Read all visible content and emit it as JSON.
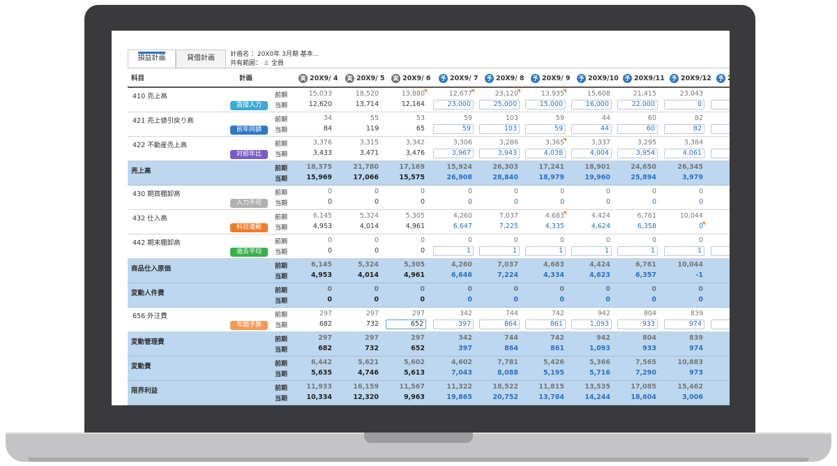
{
  "tabs": [
    {
      "label": "損益計画",
      "active": true
    },
    {
      "label": "貸借計画",
      "active": false
    }
  ],
  "plan": {
    "name_label": "計画名",
    "name_value": "：20X0年 3月期 基本...",
    "scope_label": "共有範囲：",
    "scope_value": "全員"
  },
  "header": {
    "account": "科目",
    "method": "計画",
    "months": [
      {
        "label": "20X9/ 4",
        "kind": "実"
      },
      {
        "label": "20X9/ 5",
        "kind": "実"
      },
      {
        "label": "20X9/ 6",
        "kind": "実"
      },
      {
        "label": "20X9/ 7",
        "kind": "予"
      },
      {
        "label": "20X9/ 8",
        "kind": "予"
      },
      {
        "label": "20X9/ 9",
        "kind": "予"
      },
      {
        "label": "20X9/10",
        "kind": "予"
      },
      {
        "label": "20X9/11",
        "kind": "予"
      },
      {
        "label": "20X9/12",
        "kind": "予"
      },
      {
        "label": "2",
        "kind": "予"
      }
    ]
  },
  "period_labels": {
    "prev": "前期",
    "curr": "当期"
  },
  "colors": {
    "actual_badge": "#707070",
    "forecast_badge": "#2a76c8",
    "total_row": "#bcd7ef",
    "input_text": "#2a6fc9"
  },
  "rows": [
    {
      "account": "410 売上高",
      "total": false,
      "method": "直接入力",
      "method_color": "#3aa9d8",
      "prev": [
        "15,033",
        "18,520",
        "13,880",
        "12,677",
        "23,120",
        "13,935",
        "15,608",
        "21,415",
        "23,043"
      ],
      "curr": [
        "12,620",
        "13,714",
        "12,164",
        "23,000",
        "25,000",
        "15,000",
        "16,000",
        "22,000",
        "0"
      ],
      "flags": [
        2,
        3,
        4,
        5
      ]
    },
    {
      "account": "421 売上値引戻り高",
      "total": false,
      "method": "前年同額",
      "method_color": "#2e78c7",
      "prev": [
        "34",
        "55",
        "53",
        "59",
        "103",
        "59",
        "44",
        "60",
        "82"
      ],
      "curr": [
        "84",
        "119",
        "65",
        "59",
        "103",
        "59",
        "44",
        "60",
        "82"
      ]
    },
    {
      "account": "422 不動産売上高",
      "total": false,
      "method": "対前年比",
      "method_color": "#7a5cc7",
      "prev": [
        "3,376",
        "3,315",
        "3,342",
        "3,306",
        "3,286",
        "3,365",
        "3,337",
        "3,295",
        "3,384"
      ],
      "curr": [
        "3,433",
        "3,471",
        "3,476",
        "3,967",
        "3,943",
        "4,038",
        "4,004",
        "3,954",
        "4,061"
      ],
      "flags": [
        5
      ]
    },
    {
      "account": "売上高",
      "total": true,
      "prev": [
        "18,375",
        "21,780",
        "17,169",
        "15,924",
        "26,303",
        "17,241",
        "18,901",
        "24,650",
        "26,345"
      ],
      "curr": [
        "15,969",
        "17,066",
        "15,575",
        "26,908",
        "28,840",
        "18,979",
        "19,960",
        "25,894",
        "3,979"
      ]
    },
    {
      "account": "430 期首棚卸高",
      "total": false,
      "method": "入力不可",
      "method_color": "#b0b0b0",
      "prev": [
        "0",
        "0",
        "0",
        "0",
        "0",
        "0",
        "0",
        "0",
        "0"
      ],
      "curr": [
        "0",
        "0",
        "0",
        "0",
        "0",
        "0",
        "0",
        "0",
        "0"
      ],
      "noinput": true
    },
    {
      "account": "432 仕入高",
      "total": false,
      "method": "科目連動",
      "method_color": "#f07a2a",
      "prev": [
        "6,145",
        "5,324",
        "5,305",
        "4,260",
        "7,037",
        "4,683",
        "4,424",
        "6,761",
        "10,044"
      ],
      "curr": [
        "4,953",
        "4,014",
        "4,961",
        "6,647",
        "7,225",
        "4,335",
        "4,624",
        "6,358",
        "0"
      ],
      "flags": [
        5,
        18
      ],
      "noinput": true
    },
    {
      "account": "442 期末棚卸高",
      "total": false,
      "method": "過去平均",
      "method_color": "#36b24a",
      "prev": [
        "0",
        "0",
        "0",
        "0",
        "0",
        "0",
        "0",
        "0",
        "0"
      ],
      "curr": [
        "0",
        "0",
        "0",
        "1",
        "1",
        "1",
        "1",
        "1",
        "1"
      ]
    },
    {
      "account": "商品仕入原価",
      "total": true,
      "prev": [
        "6,145",
        "5,324",
        "5,305",
        "4,260",
        "7,037",
        "4,683",
        "4,424",
        "6,761",
        "10,044"
      ],
      "curr": [
        "4,953",
        "4,014",
        "4,961",
        "6,646",
        "7,224",
        "4,334",
        "4,623",
        "6,357",
        "-1"
      ]
    },
    {
      "account": "変動人件費",
      "total": true,
      "prev": [
        "0",
        "0",
        "0",
        "0",
        "0",
        "0",
        "0",
        "0",
        "0"
      ],
      "curr": [
        "0",
        "0",
        "0",
        "0",
        "0",
        "0",
        "0",
        "0",
        "0"
      ]
    },
    {
      "account": "656 外注費",
      "total": false,
      "method": "年間予算",
      "method_color": "#f59a55",
      "prev": [
        "297",
        "297",
        "297",
        "342",
        "744",
        "742",
        "942",
        "804",
        "839"
      ],
      "curr": [
        "682",
        "732",
        "652",
        "397",
        "864",
        "861",
        "1,093",
        "933",
        "974"
      ],
      "selected": 2
    },
    {
      "account": "変動管理費",
      "total": true,
      "prev": [
        "297",
        "297",
        "297",
        "342",
        "744",
        "742",
        "942",
        "804",
        "839"
      ],
      "curr": [
        "682",
        "732",
        "652",
        "397",
        "864",
        "861",
        "1,093",
        "933",
        "974"
      ]
    },
    {
      "account": "変動費",
      "total": true,
      "prev": [
        "6,442",
        "5,621",
        "5,602",
        "4,602",
        "7,781",
        "5,426",
        "5,366",
        "7,565",
        "10,883"
      ],
      "curr": [
        "5,635",
        "4,746",
        "5,613",
        "7,043",
        "8,088",
        "5,195",
        "5,716",
        "7,290",
        "973"
      ]
    },
    {
      "account": "限界利益",
      "total": true,
      "prev": [
        "11,933",
        "16,159",
        "11,567",
        "11,322",
        "18,522",
        "11,815",
        "13,535",
        "17,085",
        "15,462"
      ],
      "curr": [
        "10,334",
        "12,320",
        "9,963",
        "19,865",
        "20,752",
        "13,784",
        "14,244",
        "18,604",
        "3,006"
      ]
    }
  ]
}
